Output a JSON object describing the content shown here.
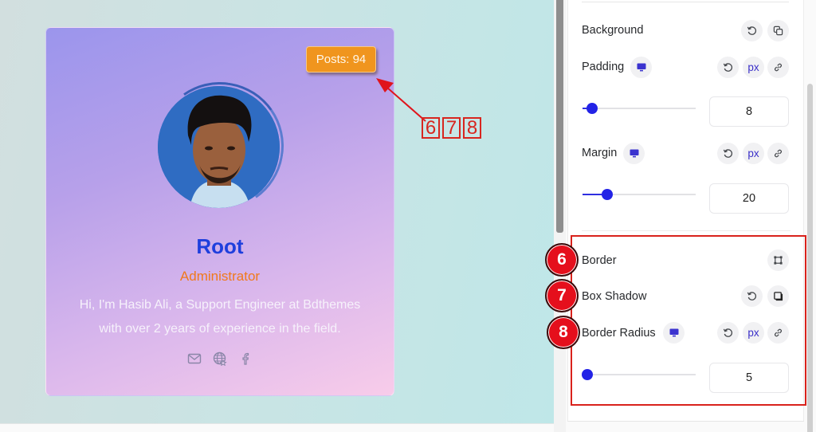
{
  "preview": {
    "card": {
      "posts_badge": "Posts: 94",
      "name": "Root",
      "role": "Administrator",
      "bio_line1": "Hi, I'm Hasib Ali, a Support Engineer at Bdthemes",
      "bio_line2": "with over 2 years of experience in the field.",
      "social_icons": [
        "mail-icon",
        "globe-icon",
        "facebook-icon"
      ]
    },
    "annotation": {
      "numbers": [
        "6",
        "7",
        "8"
      ],
      "color": "#d8261f"
    }
  },
  "panel": {
    "background": {
      "label": "Background",
      "icons": [
        "reset-icon",
        "duplicate-icon"
      ]
    },
    "padding": {
      "label": "Padding",
      "unit": "px",
      "value": "8",
      "slider_percent": 6
    },
    "margin": {
      "label": "Margin",
      "unit": "px",
      "value": "20",
      "slider_percent": 20
    },
    "border": {
      "label": "Border",
      "step": "6"
    },
    "box_shadow": {
      "label": "Box Shadow",
      "step": "7"
    },
    "border_radius": {
      "label": "Border Radius",
      "unit": "px",
      "value": "5",
      "step": "8",
      "slider_percent": 2
    }
  },
  "colors": {
    "accent": "#2323e6",
    "badge": "#f0951e",
    "name": "#1f3fdd",
    "role": "#f0791c",
    "highlight": "#d9221c"
  }
}
